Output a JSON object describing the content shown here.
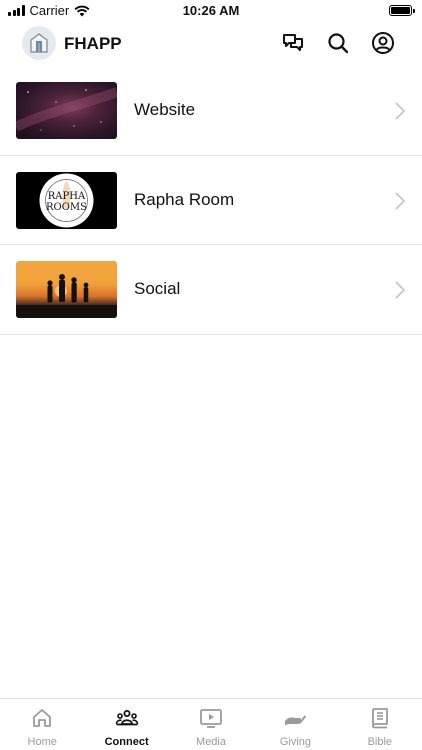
{
  "status_bar": {
    "carrier": "Carrier",
    "time": "10:26 AM"
  },
  "header": {
    "title": "FHAPP"
  },
  "list_items": [
    {
      "label": "Website"
    },
    {
      "label": "Rapha Room",
      "thumb_text_line1": "RAPHA",
      "thumb_text_line2": "ROOMS"
    },
    {
      "label": "Social"
    }
  ],
  "tabs": [
    {
      "label": "Home",
      "icon": "home-icon",
      "active": false
    },
    {
      "label": "Connect",
      "icon": "people-icon",
      "active": true
    },
    {
      "label": "Media",
      "icon": "media-play-icon",
      "active": false
    },
    {
      "label": "Giving",
      "icon": "giving-hand-icon",
      "active": false
    },
    {
      "label": "Bible",
      "icon": "bible-book-icon",
      "active": false
    }
  ],
  "colors": {
    "active_tab": "#111111",
    "inactive_tab": "#9a9a9a",
    "divider": "#e3e3e3"
  }
}
